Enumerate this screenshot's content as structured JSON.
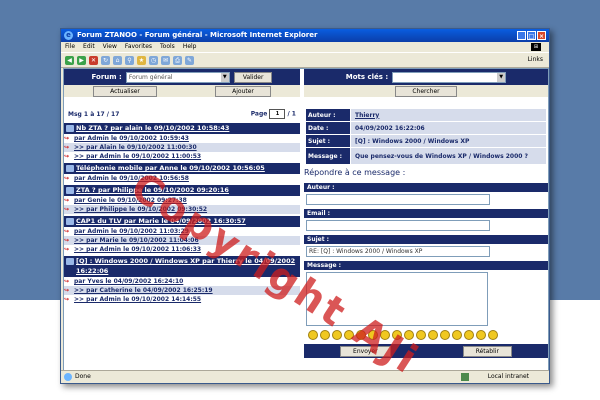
{
  "window": {
    "title": "Forum ZTANOO - Forum général - Microsoft Internet Explorer",
    "menu": [
      "File",
      "Edit",
      "View",
      "Favorites",
      "Tools",
      "Help"
    ],
    "links_label": "Links",
    "status_text": "Done",
    "zone_text": "Local intranet"
  },
  "toolbar": {
    "forum_label": "Forum :",
    "forum_selected": "Forum général",
    "validate_label": "Valider",
    "refresh_label": "Actualiser",
    "add_label": "Ajouter",
    "keywords_label": "Mots clés :",
    "search_label": "Chercher"
  },
  "thread_nav": {
    "range": "Msg 1 à 17 / 17",
    "page_label": "Page",
    "page_value": "1",
    "page_total": "/ 1"
  },
  "threads": [
    {
      "title": "Nb ZTA ? par alain le 09/10/2002 10:58:43",
      "replies": [
        "par Admin le 09/10/2002 10:59:43",
        ">> par Alain le 09/10/2002 11:00:30",
        ">> par Admin le 09/10/2002 11:00:53"
      ]
    },
    {
      "title": "Téléphonie mobile par Anne le 09/10/2002 10:56:05",
      "replies": [
        "par Admin le 09/10/2002 10:56:58"
      ]
    },
    {
      "title": "ZTA ? par Philippe le 09/10/2002 09:20:16",
      "replies": [
        "par Genie le 09/10/2002 09:27:38",
        ">> par Philippe le 09/10/2002 09:30:52"
      ]
    },
    {
      "title": "CAP1 du TLV par Marie le 04/09/2002 16:30:57",
      "replies": [
        "par Admin le 09/10/2002 11:03:29",
        ">> par Marie le 09/10/2002 11:04:06",
        ">> par Admin le 09/10/2002 11:06:33"
      ]
    },
    {
      "title": "[Q] : Windows 2000 / Windows XP par Thierry le 04/09/2002 16:22:06",
      "replies": [
        "par Yves le 04/09/2002 16:24:10",
        ">> par Catherine le 04/09/2002 16:25:19",
        ">> par Admin le 09/10/2002 14:14:55"
      ]
    }
  ],
  "message": {
    "author_label": "Auteur :",
    "author": "Thierry",
    "date_label": "Date :",
    "date": "04/09/2002 16:22:06",
    "subject_label": "Sujet :",
    "subject": "[Q] : Windows 2000 / Windows XP",
    "message_label": "Message :",
    "message": "Que pensez-vous de Windows XP / Windows 2000 ?"
  },
  "reply_form": {
    "heading": "Répondre à ce message :",
    "author_label": "Auteur :",
    "email_label": "Email :",
    "subject_label": "Sujet :",
    "subject_value": "RE: [Q] : Windows 2000 / Windows XP",
    "message_label": "Message :",
    "send_label": "Envoyer",
    "reset_label": "Rétablir"
  },
  "watermark": "Copyright AJi",
  "colors": {
    "navy": "#1a2a6a",
    "row_alt": "#d6dceb",
    "watermark": "#cd1e1e"
  }
}
